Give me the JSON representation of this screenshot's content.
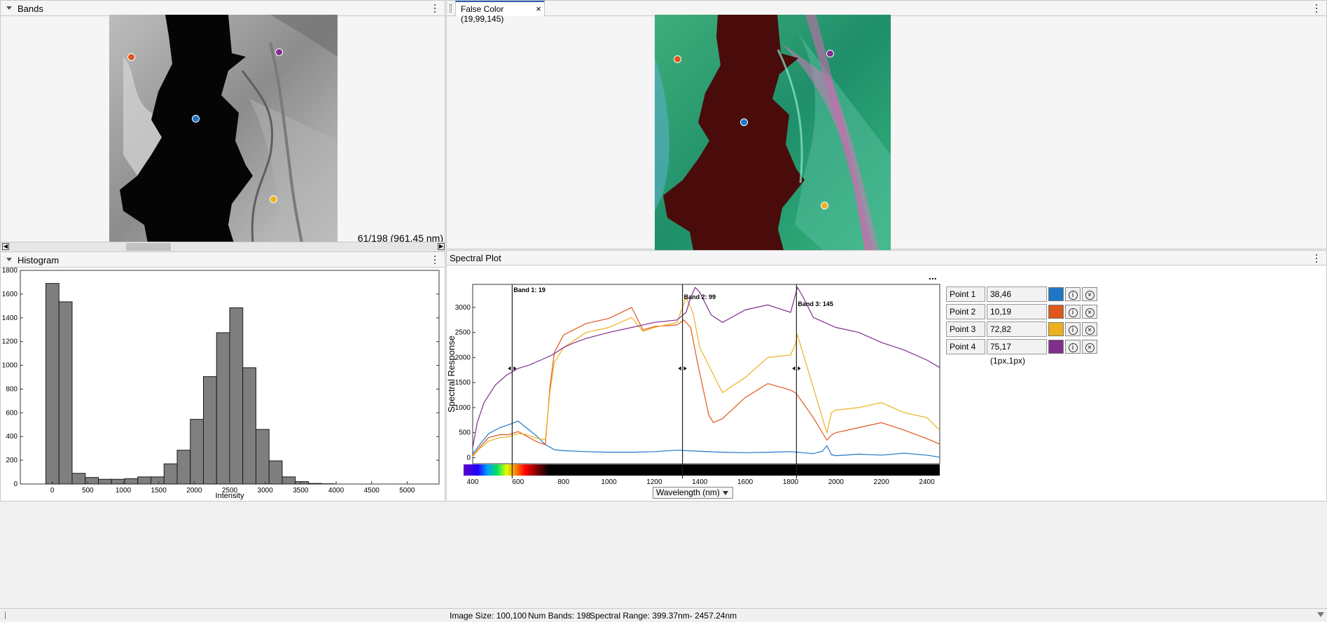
{
  "bands_panel": {
    "title": "Bands",
    "band_readout": "61/198 (961.45 nm)"
  },
  "false_color_panel": {
    "tab_label": "False Color (19,99,145)",
    "close_glyph": "×"
  },
  "histogram_panel": {
    "title": "Histogram",
    "xlabel": "Intensity",
    "x_ticks": [
      "0",
      "500",
      "1000",
      "1500",
      "2000",
      "2500",
      "3000",
      "3500",
      "4000",
      "4500",
      "5000"
    ],
    "y_ticks": [
      "0",
      "200",
      "400",
      "600",
      "800",
      "1000",
      "1200",
      "1400",
      "1600",
      "1800"
    ]
  },
  "spectral_panel": {
    "title": "Spectral Plot",
    "more_glyph": "...",
    "ylabel": "Spectral Response",
    "x_ticks": [
      "400",
      "600",
      "800",
      "1000",
      "1200",
      "1400",
      "1600",
      "1800",
      "2000",
      "2200",
      "2400"
    ],
    "y_ticks": [
      "0",
      "500",
      "1000",
      "1500",
      "2000",
      "2500",
      "3000"
    ],
    "band_labels": [
      "Band 1: 19",
      "Band 2: 99",
      "Band 3: 145"
    ],
    "xaxis_dropdown": "Wavelength (nm)"
  },
  "points": [
    {
      "name": "Point 1",
      "coords": "38,46 (1px,1px)",
      "color": "#1f77c8"
    },
    {
      "name": "Point 2",
      "coords": "10,19 (1px,1px)",
      "color": "#e0561c"
    },
    {
      "name": "Point 3",
      "coords": "72,82 (1px,1px)",
      "color": "#edb120"
    },
    {
      "name": "Point 4",
      "coords": "75,17 (1px,1px)",
      "color": "#7e2f8e"
    }
  ],
  "status_bar": {
    "image_size": "Image Size: 100,100",
    "num_bands": "Num Bands: 198",
    "spectral_range": "Spectral Range: 399.37nm- 2457.24nm"
  },
  "icons": {
    "point_info": "info-icon",
    "point_remove": "close-icon"
  },
  "chart_data": [
    {
      "type": "bar",
      "title": "",
      "xlabel": "Intensity",
      "ylabel": "",
      "bin_width": 185,
      "bin_starts": [
        -90,
        95,
        280,
        465,
        650,
        835,
        1020,
        1205,
        1390,
        1575,
        1760,
        1945,
        2130,
        2315,
        2500,
        2685,
        2870,
        3055,
        3240,
        3425,
        3610,
        3795
      ],
      "values": [
        1690,
        1535,
        90,
        55,
        40,
        40,
        45,
        60,
        60,
        170,
        285,
        545,
        905,
        1275,
        1485,
        980,
        460,
        195,
        60,
        20,
        5,
        2
      ],
      "xlim": [
        -450,
        5450
      ],
      "ylim": [
        0,
        1800
      ]
    },
    {
      "type": "line",
      "title": "",
      "xlabel": "Wavelength (nm)",
      "ylabel": "Spectral Response",
      "xlim": [
        400,
        2457
      ],
      "ylim": [
        -120,
        3460
      ],
      "band_lines": [
        {
          "label": "Band 1: 19",
          "x": 574
        },
        {
          "label": "Band 2: 99",
          "x": 1324
        },
        {
          "label": "Band 3: 145",
          "x": 1826
        }
      ],
      "series": [
        {
          "name": "Point 1",
          "color": "#1f77c8",
          "x": [
            400,
            430,
            470,
            520,
            560,
            600,
            630,
            680,
            720,
            760,
            800,
            900,
            1000,
            1100,
            1200,
            1300,
            1390,
            1500,
            1600,
            1700,
            1800,
            1900,
            1940,
            1960,
            1980,
            2000,
            2100,
            2200,
            2300,
            2400,
            2457
          ],
          "y": [
            80,
            250,
            480,
            600,
            660,
            730,
            620,
            440,
            260,
            160,
            140,
            120,
            110,
            110,
            120,
            150,
            130,
            110,
            100,
            110,
            120,
            80,
            130,
            240,
            60,
            40,
            70,
            50,
            90,
            50,
            10
          ]
        },
        {
          "name": "Point 2",
          "color": "#e0561c",
          "x": [
            400,
            430,
            470,
            520,
            560,
            600,
            630,
            680,
            720,
            740,
            760,
            800,
            900,
            1000,
            1100,
            1150,
            1200,
            1300,
            1330,
            1360,
            1390,
            1440,
            1460,
            1500,
            1600,
            1700,
            1800,
            1820,
            1830,
            1900,
            1960,
            1980,
            2000,
            2100,
            2200,
            2300,
            2400,
            2457
          ],
          "y": [
            40,
            200,
            400,
            460,
            460,
            520,
            450,
            320,
            260,
            1400,
            2100,
            2450,
            2680,
            2780,
            3000,
            2550,
            2620,
            2650,
            2750,
            2600,
            1900,
            850,
            700,
            780,
            1200,
            1480,
            1350,
            1300,
            1250,
            800,
            350,
            450,
            500,
            600,
            700,
            550,
            380,
            270
          ]
        },
        {
          "name": "Point 3",
          "color": "#edb120",
          "x": [
            400,
            430,
            470,
            520,
            560,
            600,
            630,
            680,
            720,
            740,
            760,
            800,
            900,
            1000,
            1100,
            1150,
            1200,
            1300,
            1340,
            1370,
            1400,
            1500,
            1600,
            1700,
            1800,
            1820,
            1830,
            1900,
            1960,
            1980,
            2000,
            2100,
            2200,
            2300,
            2400,
            2457
          ],
          "y": [
            20,
            180,
            330,
            400,
            420,
            480,
            470,
            390,
            360,
            1300,
            1900,
            2200,
            2500,
            2600,
            2800,
            2520,
            2600,
            2700,
            3200,
            2900,
            2200,
            1300,
            1600,
            2000,
            2050,
            2250,
            2450,
            1400,
            500,
            900,
            950,
            1000,
            1100,
            900,
            800,
            550
          ]
        },
        {
          "name": "Point 4",
          "color": "#7e2f8e",
          "x": [
            400,
            420,
            450,
            500,
            550,
            600,
            650,
            700,
            750,
            800,
            850,
            900,
            1000,
            1100,
            1200,
            1300,
            1340,
            1360,
            1380,
            1400,
            1450,
            1500,
            1600,
            1700,
            1800,
            1830,
            1850,
            1900,
            2000,
            2100,
            2200,
            2300,
            2400,
            2457
          ],
          "y": [
            200,
            700,
            1100,
            1450,
            1650,
            1780,
            1850,
            1950,
            2050,
            2200,
            2300,
            2380,
            2500,
            2600,
            2700,
            2750,
            2900,
            3200,
            3400,
            3300,
            2850,
            2700,
            2950,
            3050,
            2900,
            3400,
            3250,
            2800,
            2600,
            2500,
            2300,
            2150,
            1950,
            1800
          ]
        }
      ]
    }
  ]
}
